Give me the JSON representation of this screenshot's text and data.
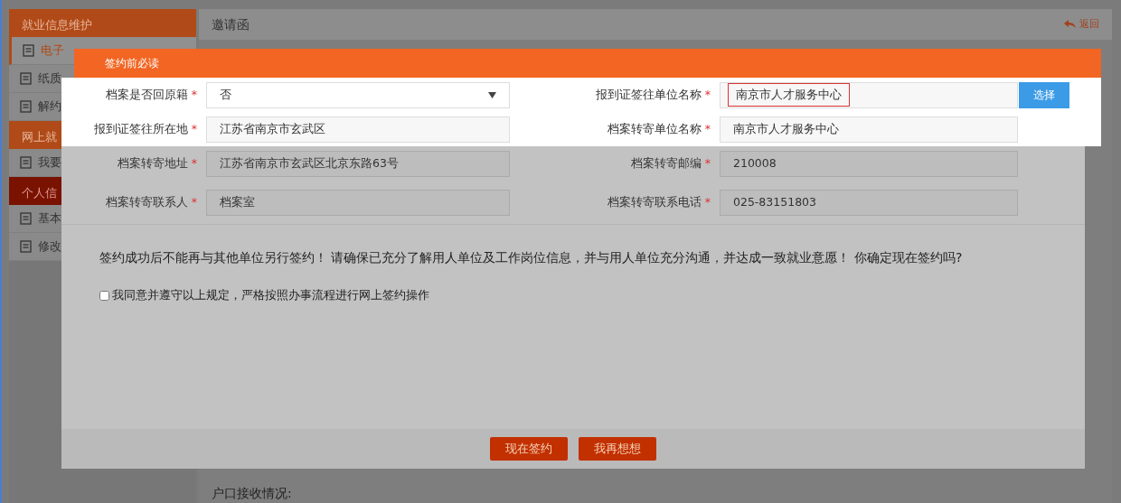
{
  "page": {
    "sidebar": [
      {
        "label": "就业信息维护",
        "kind": "header"
      },
      {
        "label": "电子",
        "kind": "item",
        "selected": true
      },
      {
        "label": "纸质",
        "kind": "item",
        "selected": false
      },
      {
        "label": "解约",
        "kind": "item",
        "selected": false
      },
      {
        "label": "网上就",
        "kind": "header"
      },
      {
        "label": "我要",
        "kind": "item",
        "selected": false
      },
      {
        "label": "个人信",
        "kind": "header-dark"
      },
      {
        "label": "基本",
        "kind": "item",
        "selected": false
      },
      {
        "label": "修改",
        "kind": "item",
        "selected": false
      }
    ],
    "title": "邀请函",
    "back": "返回",
    "footer_text": "户口接收情况:"
  },
  "modal": {
    "title": "签约前必读",
    "rows": [
      {
        "dimmed": false,
        "fields": [
          {
            "label": "档案是否回原籍",
            "mark": "*",
            "kind": "select",
            "value": "否"
          },
          {
            "label": "报到证签往单位名称",
            "mark": "*",
            "kind": "picker",
            "value": "南京市人才服务中心",
            "button": "选择"
          }
        ]
      },
      {
        "dimmed": false,
        "fields": [
          {
            "label": "报到证签往所在地",
            "mark": "*",
            "kind": "text",
            "value": "江苏省南京市玄武区"
          },
          {
            "label": "档案转寄单位名称",
            "mark": "*",
            "kind": "text",
            "value": "南京市人才服务中心"
          }
        ]
      },
      {
        "dimmed": true,
        "fields": [
          {
            "label": "档案转寄地址",
            "mark": "*",
            "kind": "text",
            "value": "江苏省南京市玄武区北京东路63号"
          },
          {
            "label": "档案转寄邮编",
            "mark": "*",
            "kind": "text",
            "value": "210008"
          }
        ]
      },
      {
        "dimmed": true,
        "fields": [
          {
            "label": "档案转寄联系人",
            "mark": "*",
            "kind": "text",
            "value": "档案室"
          },
          {
            "label": "档案转寄联系电话",
            "mark": "*",
            "kind": "text",
            "value": "025-83151803"
          }
        ]
      }
    ],
    "message": "签约成功后不能再与其他单位另行签约！ 请确保已充分了解用人单位及工作岗位信息，并与用人单位充分沟通，并达成一致就业意愿！ 你确定现在签约吗?",
    "agreement": {
      "label": "我同意并遵守以上规定，严格按照办事流程进行网上签约操作",
      "checked": false
    },
    "buttons": [
      "现在签约",
      "我再想想"
    ]
  }
}
